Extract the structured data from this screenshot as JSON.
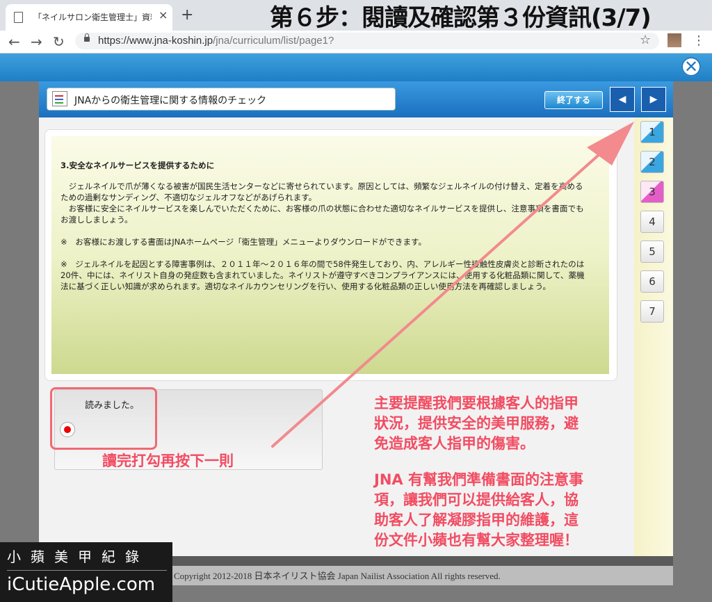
{
  "browser": {
    "tab_title": "「ネイルサロン衛生管理士」資料",
    "tab_close": "×",
    "new_tab": "+",
    "url_main": "https://www.jna-koshin.jp",
    "url_path": "/jna/curriculum/list/page1?"
  },
  "heading": "第６步：閱讀及確認第３份資訊(3/7)",
  "app": {
    "title": "JNAからの衛生管理に関する情報のチェック",
    "end_button": "終了する",
    "prev": "◀",
    "next": "▶",
    "close": "✕"
  },
  "content": {
    "heading": "3.安全なネイルサービスを提供するために",
    "paragraph1": "　ジェルネイルで爪が薄くなる被害が国民生活センターなどに寄せられています。原因としては、頻繁なジェルネイルの付け替え、定着を高めるための過剰なサンディング、不適切なジェルオフなどがあげられます。",
    "paragraph2": "　お客様に安全にネイルサービスを楽しんでいただくために、お客様の爪の状態に合わせた適切なネイルサービスを提供し、注意事項を書面でもお渡ししましょう。",
    "note1": "※　お客様にお渡しする書面はJNAホームページ「衛生管理」メニューよりダウンロードができます。",
    "note2": "※　ジェルネイルを起因とする障害事例は、２０１１年～２０１６年の間で58件発生しており、内、アレルギー性接触性皮膚炎と診断されたのは20件、中には、ネイリスト自身の発症数も含まれていました。ネイリストが遵守すべきコンプライアンスには、使用する化粧品類に関して、薬機法に基づく正しい知識が求められます。適切なネイルカウンセリングを行い、使用する化粧品類の正しい使用方法を再確認しましょう。"
  },
  "pages": [
    {
      "label": "1",
      "style": "blue"
    },
    {
      "label": "2",
      "style": "blue"
    },
    {
      "label": "3",
      "style": "pink"
    },
    {
      "label": "4",
      "style": "plain"
    },
    {
      "label": "5",
      "style": "plain"
    },
    {
      "label": "6",
      "style": "plain"
    },
    {
      "label": "7",
      "style": "plain"
    }
  ],
  "read": {
    "label": "読みました。",
    "note": "讀完打勾再按下一則"
  },
  "annotation": {
    "line1": "主要提醒我們要根據客人的指甲",
    "line2": "狀況，提供安全的美甲服務，避",
    "line3": "免造成客人指甲的傷害。",
    "line4": "JNA 有幫我們準備書面的注意事",
    "line5": "項，讓我們可以提供給客人，協",
    "line6": "助客人了解凝膠指甲的維護，這",
    "line7": "份文件小蘋也有幫大家整理喔！"
  },
  "footer": {
    "copyright": "Copyright 2012-2018 日本ネイリスト協会 Japan Nailist Association All rights reserved."
  },
  "watermark": {
    "line1": "小蘋美甲紀錄",
    "line2": "iCutieApple.com"
  },
  "colors": {
    "accent": "#1f7fc6",
    "annotation": "#f24c62"
  }
}
